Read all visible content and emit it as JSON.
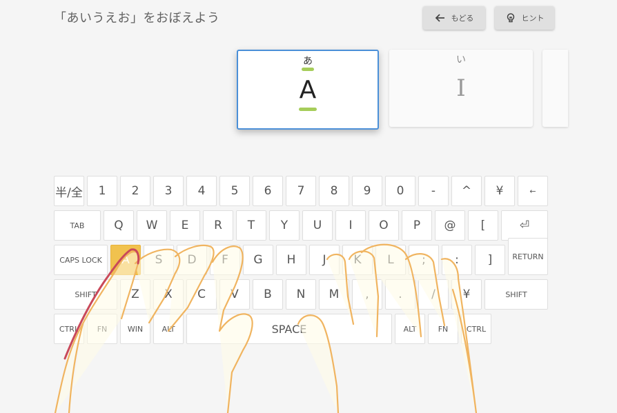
{
  "header": {
    "title": "「あいうえお」をおぼえよう"
  },
  "buttons": {
    "back_label": "もどる",
    "back_icon": "arrow-left-icon",
    "hint_label": "ヒント",
    "hint_icon": "lightbulb-icon"
  },
  "cards": {
    "current": {
      "kana": "あ",
      "romaji": "A"
    },
    "next": {
      "kana": "い",
      "romaji": "I"
    }
  },
  "keyboard": {
    "row1": [
      "半/全",
      "1",
      "2",
      "3",
      "4",
      "5",
      "6",
      "7",
      "8",
      "9",
      "0",
      "-",
      "^",
      "¥",
      "←"
    ],
    "row2": [
      "TAB",
      "Q",
      "W",
      "E",
      "R",
      "T",
      "Y",
      "U",
      "I",
      "O",
      "P",
      "@",
      "[",
      "⏎"
    ],
    "row3": [
      "CAPS LOCK",
      "A",
      "S",
      "D",
      "F",
      "G",
      "H",
      "J",
      "K",
      "L",
      ";",
      ":",
      "]",
      "RETURN"
    ],
    "row4": [
      "SHIFT",
      "Z",
      "X",
      "C",
      "V",
      "B",
      "N",
      "M",
      ",",
      ".",
      "/",
      "¥",
      "SHIFT"
    ],
    "row5": [
      "CTRL",
      "FN",
      "WIN",
      "ALT",
      "SPACE",
      "ALT",
      "FN",
      "CTRL"
    ],
    "highlighted_key": "A"
  },
  "colors": {
    "accent_blue": "#4a8fd8",
    "highlight_key": "#f1c24e",
    "underline_green": "#a6cd5a",
    "finger_guide": "#c9495a",
    "hand_outline": "#f0b460",
    "hand_fill": "#fffbe6"
  }
}
